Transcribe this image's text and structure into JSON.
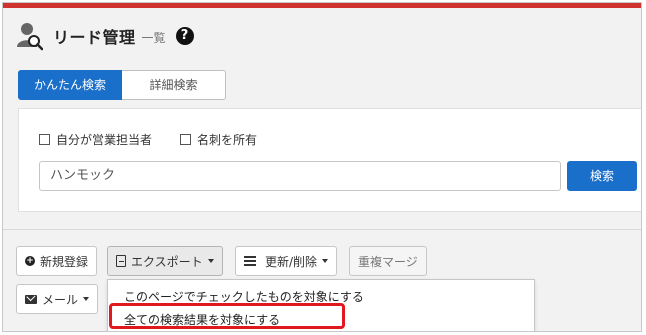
{
  "header": {
    "title": "リード管理",
    "subtitle": "一覧",
    "help_symbol": "?"
  },
  "tabs": [
    {
      "label": "かんたん検索",
      "active": true
    },
    {
      "label": "詳細検索",
      "active": false
    }
  ],
  "filters": {
    "checkbox_sales_owner": {
      "label": "自分が営業担当者",
      "checked": false
    },
    "checkbox_business_card": {
      "label": "名刺を所有",
      "checked": false
    }
  },
  "search": {
    "value": "ハンモック",
    "button_label": "検索"
  },
  "toolbar": {
    "new_register_label": "新規登録",
    "export_label": "エクスポート",
    "update_delete_label": "更新/削除",
    "duplicate_merge_label": "重複マージ",
    "mail_label": "メール"
  },
  "export_menu": {
    "items": [
      "このページでチェックしたものを対象にする",
      "全ての検索結果を対象にする"
    ]
  },
  "colors": {
    "accent_blue": "#1a6fca",
    "top_bar_red": "#d0322f",
    "highlight_red": "#e0191e"
  },
  "icons": {
    "page": "user-search-icon",
    "help": "help-circle-icon",
    "new": "plus-circle-icon",
    "export": "document-icon",
    "update": "list-icon",
    "mail": "envelope-icon"
  }
}
